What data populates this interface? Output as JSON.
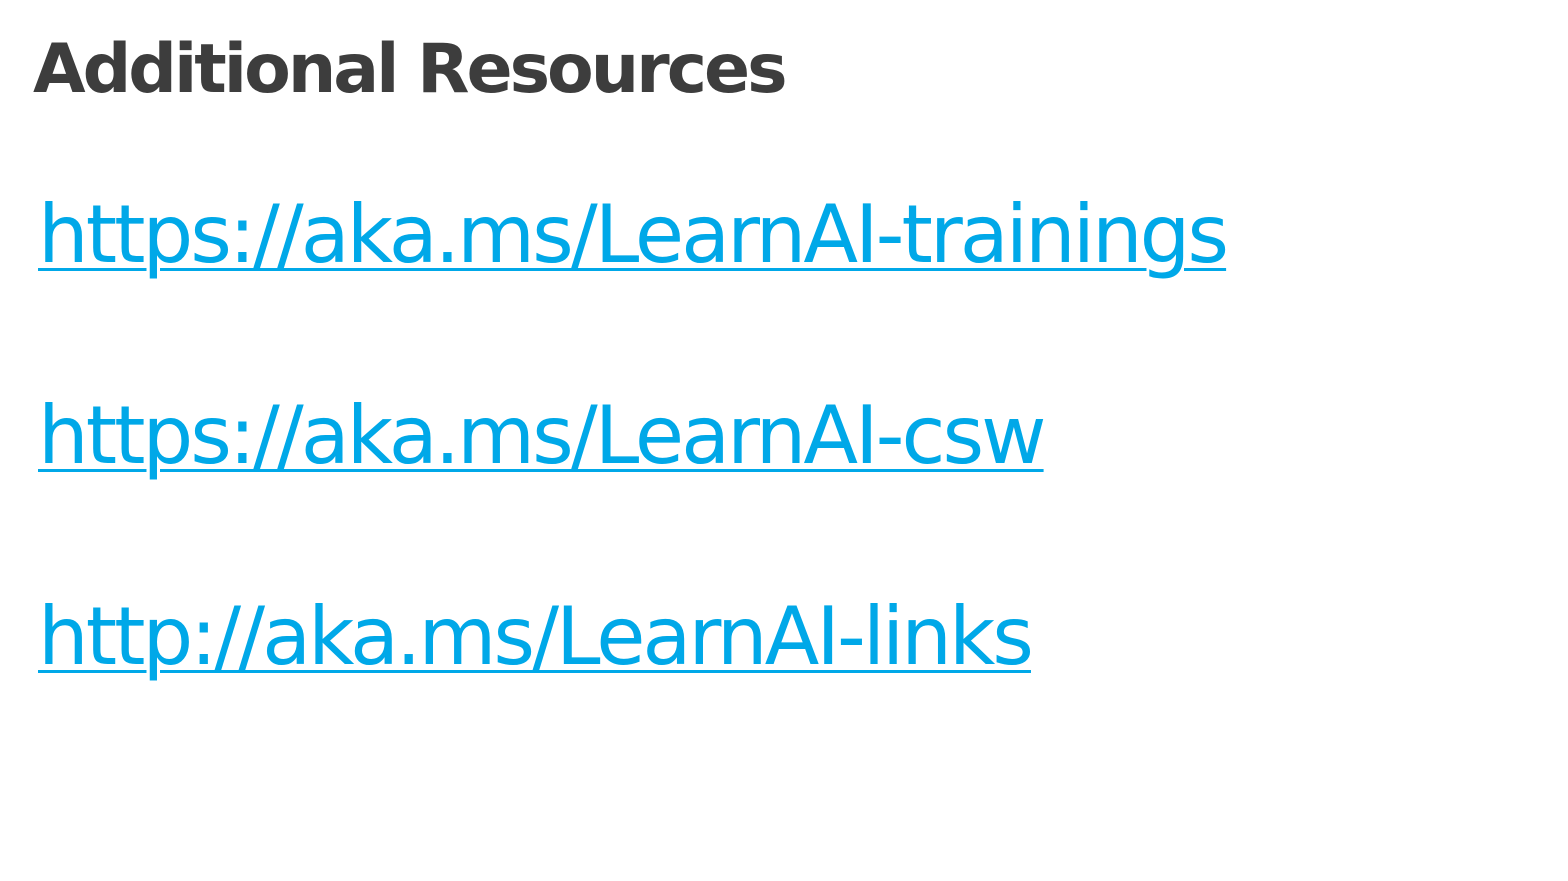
{
  "slide": {
    "title": "Additional Resources",
    "link_color": "#00a8e8",
    "title_color": "#3d3d3d",
    "links": [
      {
        "label": "https://aka.ms/LearnAI-trainings"
      },
      {
        "label": "https://aka.ms/LearnAI-csw"
      },
      {
        "label": "http://aka.ms/LearnAI-links"
      }
    ]
  }
}
